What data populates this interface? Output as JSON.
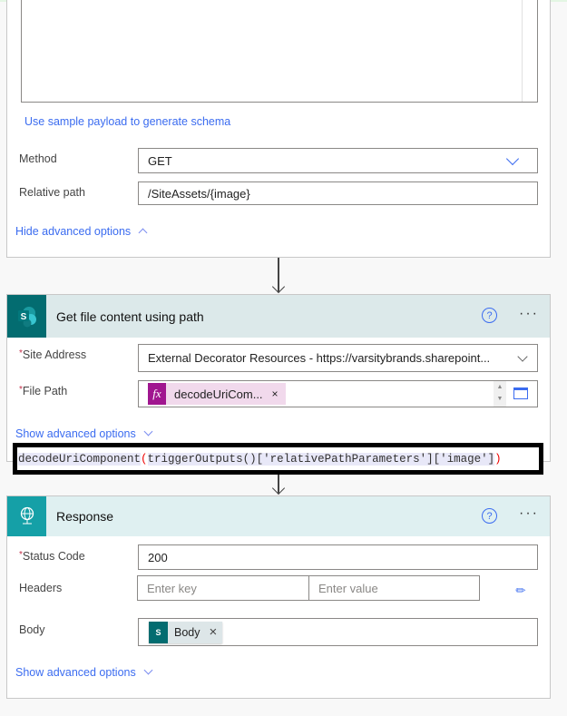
{
  "http_trigger": {
    "sample_payload_link": "Use sample payload to generate schema",
    "method_label": "Method",
    "method_value": "GET",
    "relative_path_label": "Relative path",
    "relative_path_value": "/SiteAssets/{image}",
    "hide_advanced": "Hide advanced options"
  },
  "get_file": {
    "title": "Get file content using path",
    "icon": "sharepoint-icon",
    "header_color": "#dce9ea",
    "icon_color": "#036c70",
    "site_address_label": "Site Address",
    "site_address_value": "External Decorator Resources - https://varsitybrands.sharepoint...",
    "file_path_label": "File Path",
    "file_path_token": "decodeUriCom...",
    "show_advanced": "Show advanced options",
    "expression": {
      "fn": "decodeUriComponent",
      "open": "(",
      "inner": "triggerOutputs()['relativePathParameters']['image']",
      "close": ")"
    }
  },
  "response": {
    "title": "Response",
    "icon": "globe-icon",
    "header_color": "#dff0f1",
    "icon_color": "#15a0a7",
    "status_code_label": "Status Code",
    "status_code_value": "200",
    "headers_label": "Headers",
    "key_placeholder": "Enter key",
    "value_placeholder": "Enter value",
    "body_label": "Body",
    "body_token": "Body",
    "show_advanced": "Show advanced options"
  }
}
